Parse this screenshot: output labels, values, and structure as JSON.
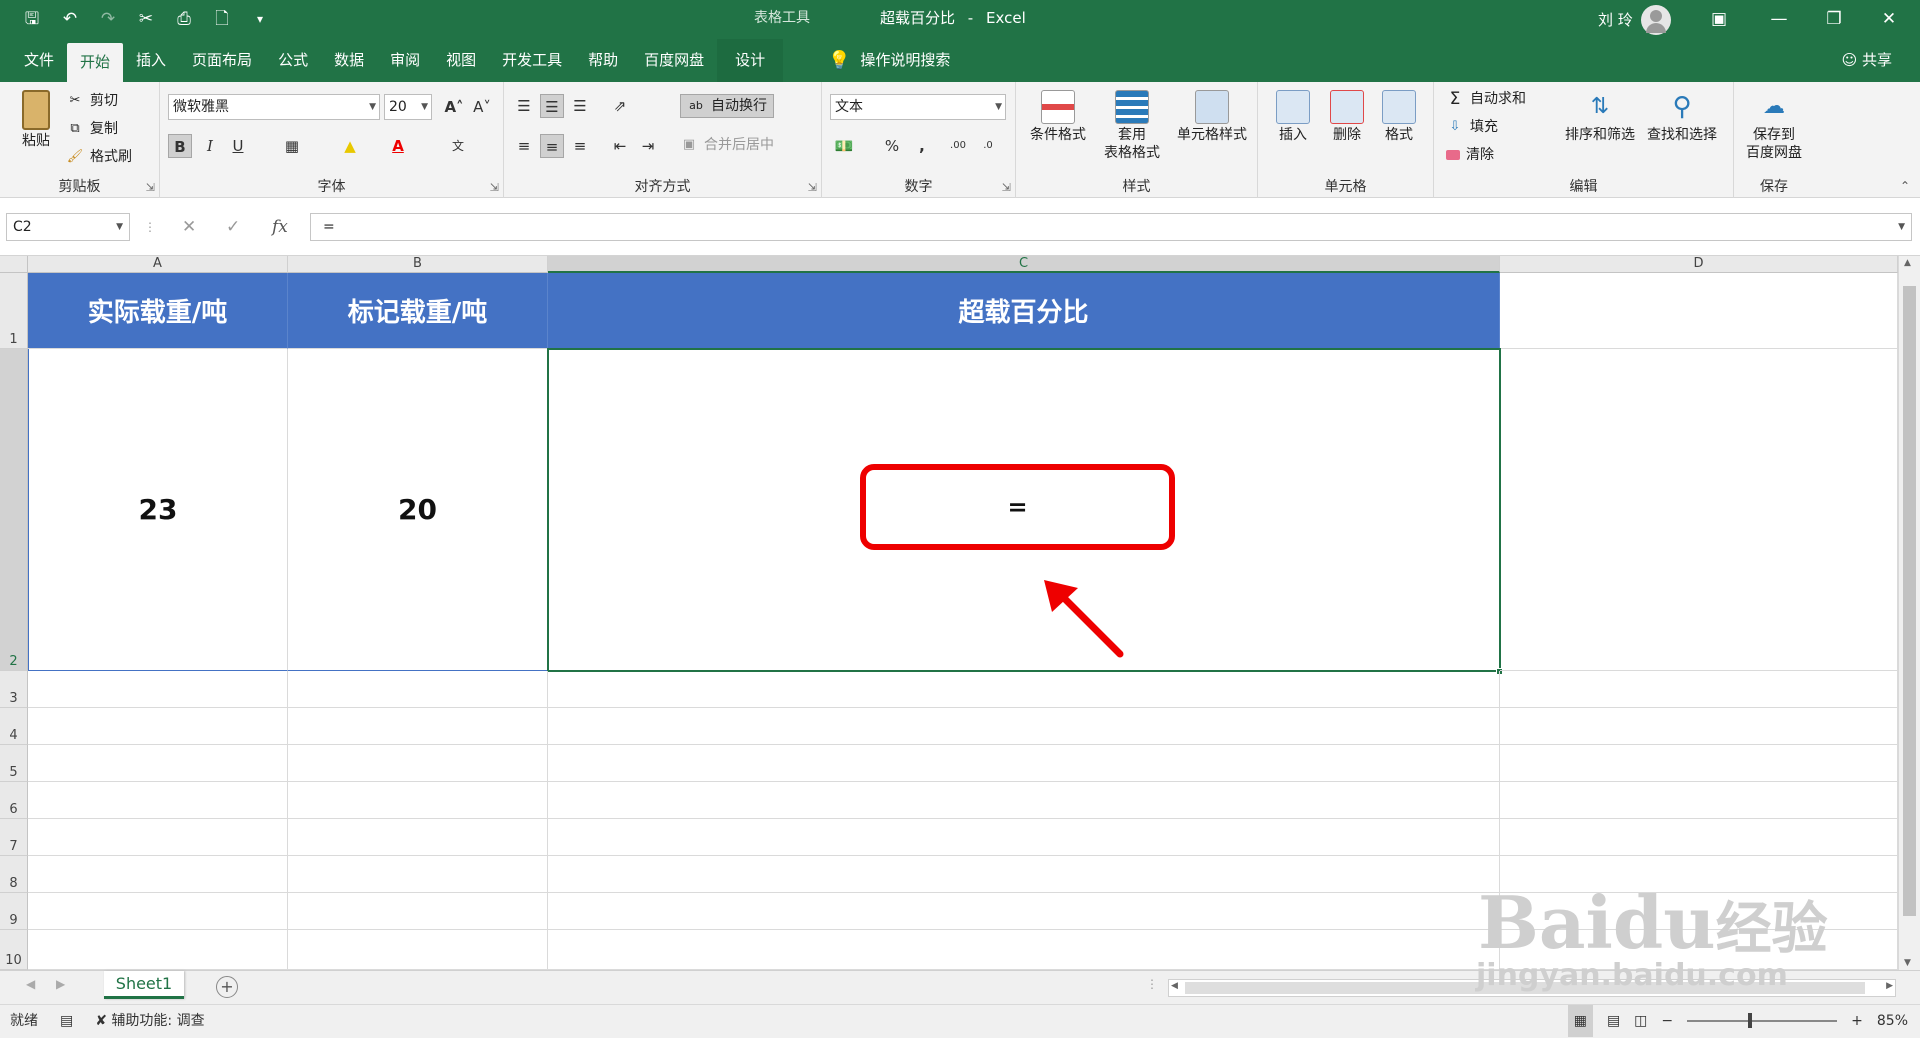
{
  "titlebar": {
    "context_tools": "表格工具",
    "doc_name": "超载百分比",
    "separator": "-",
    "app_name": "Excel",
    "user_name": "刘 玲"
  },
  "tabs": [
    "文件",
    "开始",
    "插入",
    "页面布局",
    "公式",
    "数据",
    "审阅",
    "视图",
    "开发工具",
    "帮助",
    "百度网盘",
    "设计"
  ],
  "active_tab": "开始",
  "tellme": "操作说明搜索",
  "share": "共享",
  "ribbon": {
    "clipboard": {
      "label": "剪贴板",
      "paste": "粘贴",
      "cut": "剪切",
      "copy": "复制",
      "format_painter": "格式刷"
    },
    "font": {
      "label": "字体",
      "font_name": "微软雅黑",
      "font_size": "20",
      "bold": "B",
      "italic": "I",
      "underline": "U",
      "font_color_letter": "A"
    },
    "alignment": {
      "label": "对齐方式",
      "wrap_text": "自动换行",
      "merge_center": "合并后居中"
    },
    "number": {
      "label": "数字",
      "format": "文本",
      "percent": "%",
      "comma": ","
    },
    "styles": {
      "label": "样式",
      "conditional": "条件格式",
      "table_format_1": "套用",
      "table_format_2": "表格格式",
      "cell_styles": "单元格样式"
    },
    "cells": {
      "label": "单元格",
      "insert": "插入",
      "delete": "删除",
      "format": "格式"
    },
    "editing": {
      "label": "编辑",
      "autosum": "自动求和",
      "fill": "填充",
      "clear": "清除",
      "sort_filter": "排序和筛选",
      "find_select": "查找和选择"
    },
    "save": {
      "label": "保存",
      "save_to_1": "保存到",
      "save_to_2": "百度网盘"
    }
  },
  "formula_bar": {
    "name_box": "C2",
    "fx": "fx",
    "formula": "="
  },
  "columns": [
    "A",
    "B",
    "C",
    "D"
  ],
  "rows": [
    "1",
    "2",
    "3",
    "4",
    "5",
    "6",
    "7",
    "8",
    "9",
    "10"
  ],
  "cells": {
    "A1": "实际载重/吨",
    "B1": "标记载重/吨",
    "C1": "超载百分比",
    "A2": "23",
    "B2": "20",
    "C2": "="
  },
  "colors": {
    "excel_green": "#217346",
    "header_fill": "#4472c4",
    "highlight_red": "#ee0000"
  },
  "sheet_tabs": [
    "Sheet1"
  ],
  "status": {
    "ready": "就绪",
    "accessibility": "辅助功能: 调查",
    "zoom": "85%"
  },
  "watermark": {
    "logo": "Baidu",
    "cn": "经验",
    "url": "jingyan.baidu.com"
  }
}
